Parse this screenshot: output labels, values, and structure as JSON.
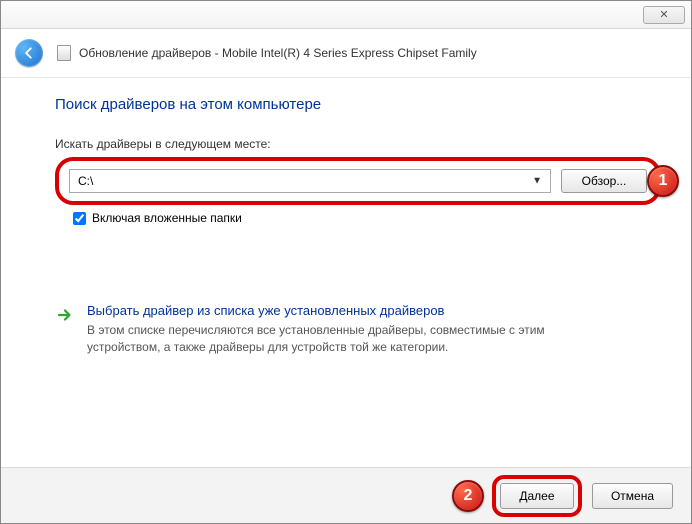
{
  "window": {
    "close_glyph": "✕",
    "title": "Обновление драйверов - Mobile Intel(R) 4 Series Express Chipset Family"
  },
  "content": {
    "heading": "Поиск драйверов на этом компьютере",
    "search_label": "Искать драйверы в следующем месте:",
    "path_value": "C:\\",
    "browse_label": "Обзор...",
    "include_subfolders": "Включая вложенные папки",
    "pick_title": "Выбрать драйвер из списка уже установленных драйверов",
    "pick_desc": "В этом списке перечисляются все установленные драйверы, совместимые с этим устройством, а также драйверы для устройств той же категории."
  },
  "footer": {
    "next": "Далее",
    "cancel": "Отмена"
  },
  "annotations": {
    "badge1": "1",
    "badge2": "2"
  }
}
